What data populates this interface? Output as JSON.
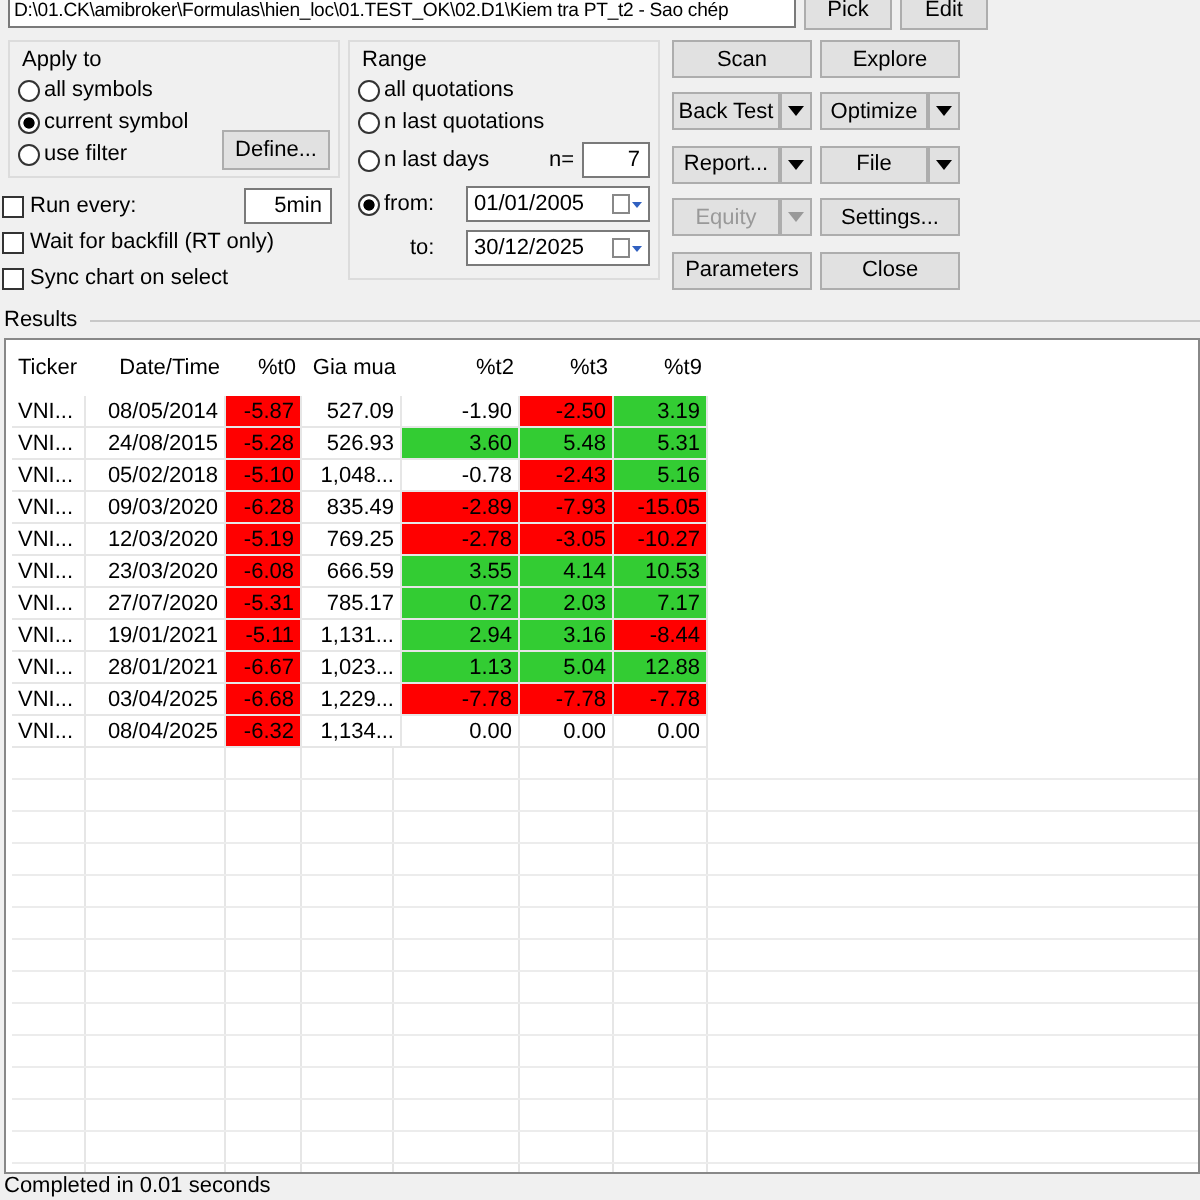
{
  "formula_path": {
    "value": "D:\\01.CK\\amibroker\\Formulas\\hien_loc\\01.TEST_OK\\02.D1\\Kiem tra PT_t2 - Sao chép"
  },
  "path_buttons": [
    "Pick",
    "Edit"
  ],
  "apply_to": {
    "title": "Apply to",
    "options": [
      {
        "label": "all symbols",
        "selected": false
      },
      {
        "label": "current symbol",
        "selected": true
      },
      {
        "label": "use filter",
        "selected": false
      }
    ],
    "define_button": "Define..."
  },
  "range": {
    "title": "Range",
    "options": [
      {
        "label": "all quotations",
        "selected": false
      },
      {
        "label": "n last quotations",
        "selected": false
      },
      {
        "label": "n last days",
        "selected": false
      },
      {
        "label": "from:",
        "selected": true
      }
    ],
    "n_label": "n=",
    "n_value": "7",
    "to_label": "to:",
    "from_date": "01/01/2005",
    "to_date": "30/12/2025"
  },
  "run_every": {
    "label": "Run every:",
    "checked": false,
    "value": "5min"
  },
  "checkboxes": [
    {
      "label": "Wait for backfill (RT only)",
      "checked": false
    },
    {
      "label": "Sync chart on select",
      "checked": false
    }
  ],
  "actions": [
    {
      "label": "Scan",
      "kind": "plain",
      "disabled": false
    },
    {
      "label": "Explore",
      "kind": "plain",
      "disabled": false
    },
    {
      "label": "Back Test",
      "kind": "split",
      "disabled": false
    },
    {
      "label": "Optimize",
      "kind": "split",
      "disabled": false
    },
    {
      "label": "Report...",
      "kind": "split",
      "disabled": false
    },
    {
      "label": "File",
      "kind": "split",
      "disabled": false
    },
    {
      "label": "Equity",
      "kind": "split",
      "disabled": true
    },
    {
      "label": "Settings...",
      "kind": "plain",
      "disabled": false
    },
    {
      "label": "Parameters",
      "kind": "plain",
      "disabled": false
    },
    {
      "label": "Close",
      "kind": "plain",
      "disabled": false
    }
  ],
  "results": {
    "title": "Results",
    "columns": [
      "Ticker",
      "Date/Time",
      "%t0",
      "Gia mua",
      "%t2",
      "%t3",
      "%t9"
    ],
    "rows": [
      [
        {
          "text": "VNI..."
        },
        {
          "text": "08/05/2014"
        },
        {
          "text": "-5.87",
          "color": "#ff0000"
        },
        {
          "text": "527.09"
        },
        {
          "text": "-1.90"
        },
        {
          "text": "-2.50",
          "color": "#ff0000"
        },
        {
          "text": "3.19",
          "color": "#33cc33"
        }
      ],
      [
        {
          "text": "VNI..."
        },
        {
          "text": "24/08/2015"
        },
        {
          "text": "-5.28",
          "color": "#ff0000"
        },
        {
          "text": "526.93"
        },
        {
          "text": "3.60",
          "color": "#33cc33"
        },
        {
          "text": "5.48",
          "color": "#33cc33"
        },
        {
          "text": "5.31",
          "color": "#33cc33"
        }
      ],
      [
        {
          "text": "VNI..."
        },
        {
          "text": "05/02/2018"
        },
        {
          "text": "-5.10",
          "color": "#ff0000"
        },
        {
          "text": "1,048..."
        },
        {
          "text": "-0.78"
        },
        {
          "text": "-2.43",
          "color": "#ff0000"
        },
        {
          "text": "5.16",
          "color": "#33cc33"
        }
      ],
      [
        {
          "text": "VNI..."
        },
        {
          "text": "09/03/2020"
        },
        {
          "text": "-6.28",
          "color": "#ff0000"
        },
        {
          "text": "835.49"
        },
        {
          "text": "-2.89",
          "color": "#ff0000"
        },
        {
          "text": "-7.93",
          "color": "#ff0000"
        },
        {
          "text": "-15.05",
          "color": "#ff0000"
        }
      ],
      [
        {
          "text": "VNI..."
        },
        {
          "text": "12/03/2020"
        },
        {
          "text": "-5.19",
          "color": "#ff0000"
        },
        {
          "text": "769.25"
        },
        {
          "text": "-2.78",
          "color": "#ff0000"
        },
        {
          "text": "-3.05",
          "color": "#ff0000"
        },
        {
          "text": "-10.27",
          "color": "#ff0000"
        }
      ],
      [
        {
          "text": "VNI..."
        },
        {
          "text": "23/03/2020"
        },
        {
          "text": "-6.08",
          "color": "#ff0000"
        },
        {
          "text": "666.59"
        },
        {
          "text": "3.55",
          "color": "#33cc33"
        },
        {
          "text": "4.14",
          "color": "#33cc33"
        },
        {
          "text": "10.53",
          "color": "#33cc33"
        }
      ],
      [
        {
          "text": "VNI..."
        },
        {
          "text": "27/07/2020"
        },
        {
          "text": "-5.31",
          "color": "#ff0000"
        },
        {
          "text": "785.17"
        },
        {
          "text": "0.72",
          "color": "#33cc33"
        },
        {
          "text": "2.03",
          "color": "#33cc33"
        },
        {
          "text": "7.17",
          "color": "#33cc33"
        }
      ],
      [
        {
          "text": "VNI..."
        },
        {
          "text": "19/01/2021"
        },
        {
          "text": "-5.11",
          "color": "#ff0000"
        },
        {
          "text": "1,131..."
        },
        {
          "text": "2.94",
          "color": "#33cc33"
        },
        {
          "text": "3.16",
          "color": "#33cc33"
        },
        {
          "text": "-8.44",
          "color": "#ff0000"
        }
      ],
      [
        {
          "text": "VNI..."
        },
        {
          "text": "28/01/2021"
        },
        {
          "text": "-6.67",
          "color": "#ff0000"
        },
        {
          "text": "1,023..."
        },
        {
          "text": "1.13",
          "color": "#33cc33"
        },
        {
          "text": "5.04",
          "color": "#33cc33"
        },
        {
          "text": "12.88",
          "color": "#33cc33"
        }
      ],
      [
        {
          "text": "VNI..."
        },
        {
          "text": "03/04/2025"
        },
        {
          "text": "-6.68",
          "color": "#ff0000"
        },
        {
          "text": "1,229..."
        },
        {
          "text": "-7.78",
          "color": "#ff0000"
        },
        {
          "text": "-7.78",
          "color": "#ff0000"
        },
        {
          "text": "-7.78",
          "color": "#ff0000"
        }
      ],
      [
        {
          "text": "VNI..."
        },
        {
          "text": "08/04/2025"
        },
        {
          "text": "-6.32",
          "color": "#ff0000"
        },
        {
          "text": "1,134..."
        },
        {
          "text": "0.00"
        },
        {
          "text": "0.00"
        },
        {
          "text": "0.00"
        }
      ]
    ]
  },
  "status_bar": "Completed in 0.01 seconds"
}
